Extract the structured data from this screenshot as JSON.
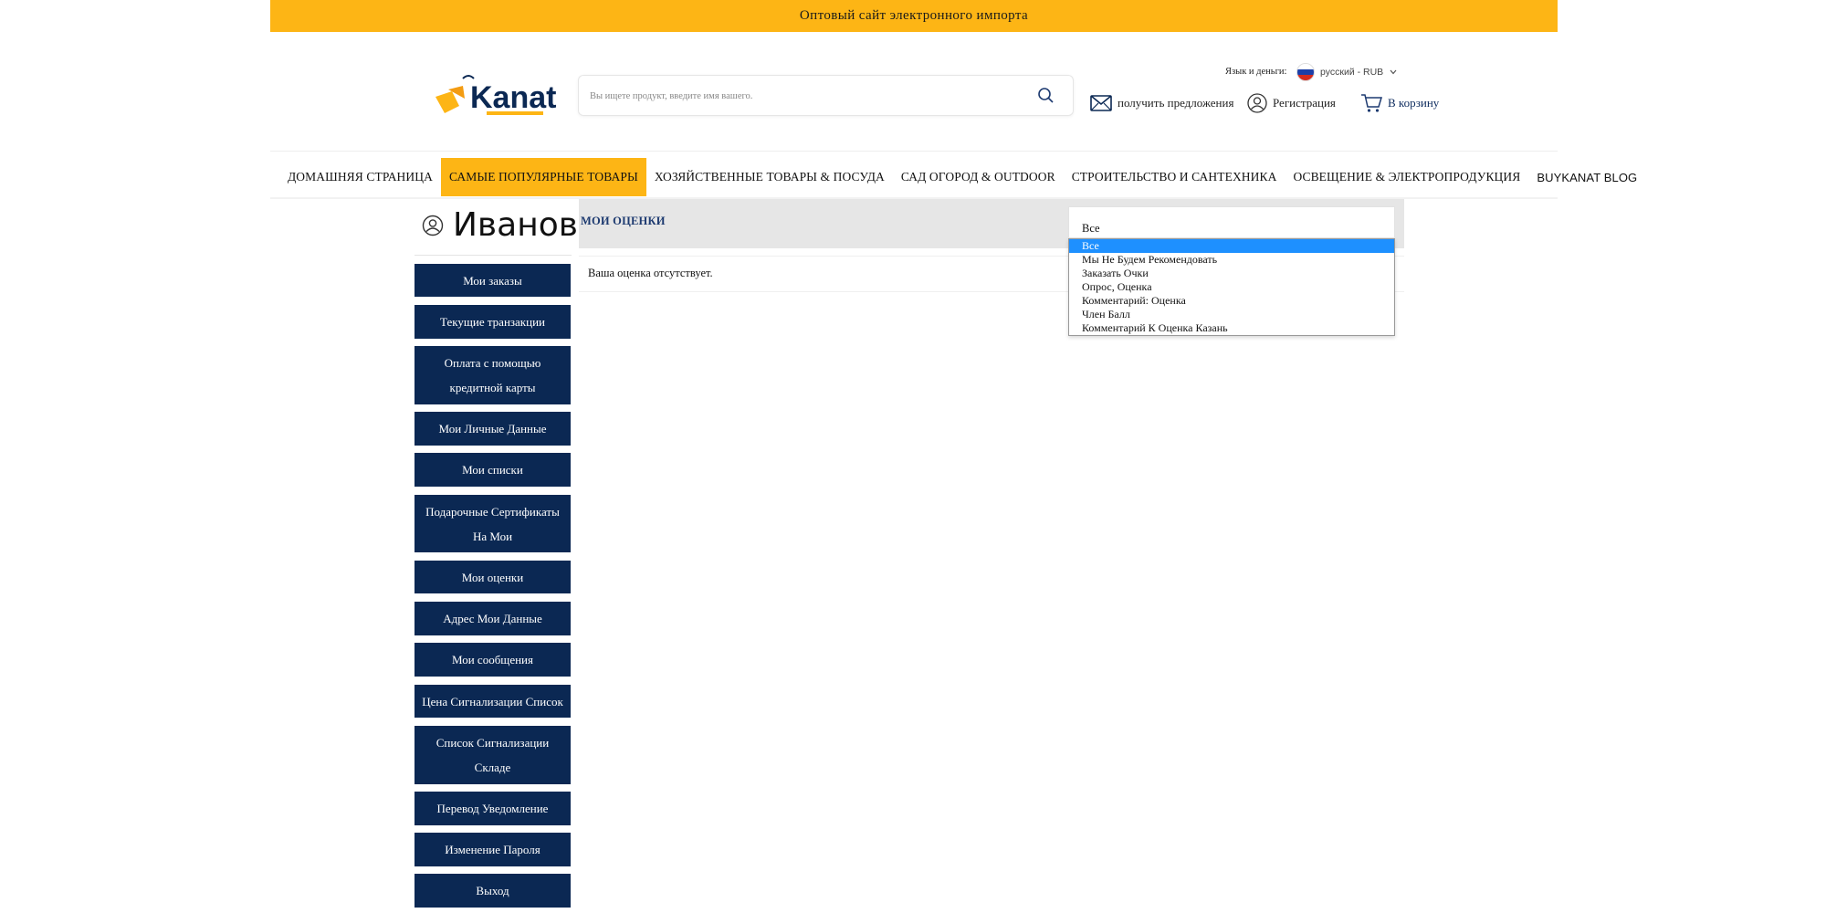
{
  "topbar": {
    "text": "Оптовый сайт электронного импорта"
  },
  "header": {
    "logo_text": "Kanat",
    "search_placeholder": "Вы ищете продукт, введите имя вашего.",
    "lang_label": "Язык и деньги:",
    "lang_value": "русский - RUB",
    "offers": "получить предложения",
    "register": "Регистрация",
    "cart": "В корзину"
  },
  "nav": {
    "items": [
      "ДОМАШНЯЯ СТРАНИЦА",
      "САМЫЕ ПОПУЛЯРНЫЕ ТОВАРЫ",
      "ХОЗЯЙСТВЕННЫЕ ТОВАРЫ & ПОСУДА",
      "САД ОГОРОД & OUTDOOR",
      "СТРОИТЕЛЬСТВО И САНТЕХНИКА",
      "ОСВЕЩЕНИЕ & ЭЛЕКТРОПРОДУКЦИЯ",
      "BUYKANAT BLOG"
    ],
    "active_index": 1
  },
  "sidebar": {
    "user_name": "Иванов",
    "items": [
      "Мои заказы",
      "Текущие транзакции",
      "Оплата с помощью кредитной карты",
      "Мои Личные Данные",
      "Мои списки",
      "Подарочные Сертификаты На Мои",
      "Мои оценки",
      "Адрес Мои Данные",
      "Мои сообщения",
      "Цена Сигнализации Список",
      "Список Сигнализации Складе",
      "Перевод Уведомление",
      "Изменение Пароля",
      "Выход"
    ]
  },
  "main": {
    "title": "МОИ ОЦЕНКИ",
    "empty_message": "Ваша оценка отсутствует.",
    "filter": {
      "selected": "Все",
      "options": [
        "Все",
        "Мы Не Будем Рекомендовать",
        "Заказать Очки",
        "Опрос, Оценка",
        "Комментарий: Оценка",
        "Член Балл",
        "Комментарий К Оценка Казань"
      ],
      "highlighted_index": 0
    }
  },
  "colors": {
    "accent_yellow": "#fdb515",
    "navy": "#0b2853",
    "title_blue": "#1d3a70",
    "option_highlight": "#1e90ff"
  }
}
